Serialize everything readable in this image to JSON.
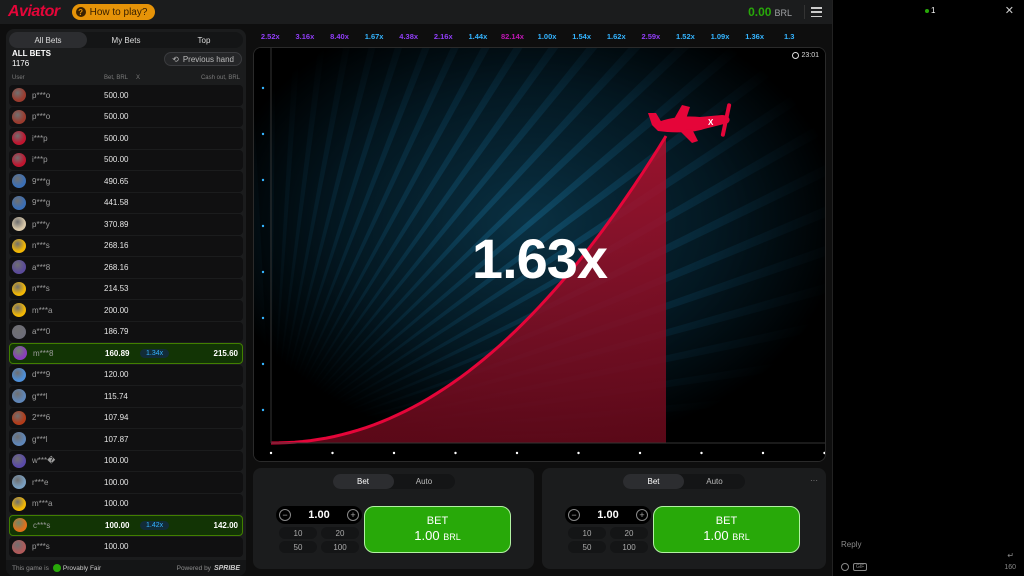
{
  "topbar": {
    "logo": "Aviator",
    "how_to_play": "How to play?",
    "balance_amount": "0.00",
    "balance_currency": "BRL"
  },
  "bets_panel": {
    "tabs": [
      "All Bets",
      "My Bets",
      "Top"
    ],
    "active_tab": "All Bets",
    "title": "ALL BETS",
    "count": "1176",
    "previous_hand": "Previous hand",
    "columns": {
      "user": "User",
      "bet": "Bet, BRL",
      "x": "X",
      "cashout": "Cash out, BRL"
    },
    "rows": [
      {
        "user": "p***o",
        "bet": "500.00",
        "mult": "",
        "cash": "",
        "win": false,
        "avatar": "#9b3b2e"
      },
      {
        "user": "p***o",
        "bet": "500.00",
        "mult": "",
        "cash": "",
        "win": false,
        "avatar": "#9b3b2e"
      },
      {
        "user": "i***p",
        "bet": "500.00",
        "mult": "",
        "cash": "",
        "win": false,
        "avatar": "#c0152f"
      },
      {
        "user": "i***p",
        "bet": "500.00",
        "mult": "",
        "cash": "",
        "win": false,
        "avatar": "#c0152f"
      },
      {
        "user": "9***g",
        "bet": "490.65",
        "mult": "",
        "cash": "",
        "win": false,
        "avatar": "#3b6fb6"
      },
      {
        "user": "9***g",
        "bet": "441.58",
        "mult": "",
        "cash": "",
        "win": false,
        "avatar": "#3b6fb6"
      },
      {
        "user": "p***y",
        "bet": "370.89",
        "mult": "",
        "cash": "",
        "win": false,
        "avatar": "#d8c7a8"
      },
      {
        "user": "n***s",
        "bet": "268.16",
        "mult": "",
        "cash": "",
        "win": false,
        "avatar": "#f2b705"
      },
      {
        "user": "a***8",
        "bet": "268.16",
        "mult": "",
        "cash": "",
        "win": false,
        "avatar": "#5b4b9a"
      },
      {
        "user": "n***s",
        "bet": "214.53",
        "mult": "",
        "cash": "",
        "win": false,
        "avatar": "#f2b705"
      },
      {
        "user": "m***a",
        "bet": "200.00",
        "mult": "",
        "cash": "",
        "win": false,
        "avatar": "#f2b705"
      },
      {
        "user": "a***0",
        "bet": "186.79",
        "mult": "",
        "cash": "",
        "win": false,
        "avatar": "#6d6d78"
      },
      {
        "user": "m***8",
        "bet": "160.89",
        "mult": "1.34x",
        "cash": "215.60",
        "win": true,
        "avatar": "#8a3dbd"
      },
      {
        "user": "d***9",
        "bet": "120.00",
        "mult": "",
        "cash": "",
        "win": false,
        "avatar": "#4e8fd8"
      },
      {
        "user": "g***l",
        "bet": "115.74",
        "mult": "",
        "cash": "",
        "win": false,
        "avatar": "#5f86b8"
      },
      {
        "user": "2***6",
        "bet": "107.94",
        "mult": "",
        "cash": "",
        "win": false,
        "avatar": "#b23c1a"
      },
      {
        "user": "g***l",
        "bet": "107.87",
        "mult": "",
        "cash": "",
        "win": false,
        "avatar": "#5f86b8"
      },
      {
        "user": "w***�",
        "bet": "100.00",
        "mult": "",
        "cash": "",
        "win": false,
        "avatar": "#5a4aa8"
      },
      {
        "user": "r***e",
        "bet": "100.00",
        "mult": "",
        "cash": "",
        "win": false,
        "avatar": "#7a9fc0"
      },
      {
        "user": "m***a",
        "bet": "100.00",
        "mult": "",
        "cash": "",
        "win": false,
        "avatar": "#f2b705"
      },
      {
        "user": "c***s",
        "bet": "100.00",
        "mult": "1.42x",
        "cash": "142.00",
        "win": true,
        "avatar": "#e0701a"
      },
      {
        "user": "p***s",
        "bet": "100.00",
        "mult": "",
        "cash": "",
        "win": false,
        "avatar": "#b05a5a"
      }
    ],
    "footer": {
      "this_game_is": "This game is",
      "provably_fair": "Provably Fair",
      "powered_by": "Powered by",
      "brand": "SPRIBE"
    }
  },
  "history": [
    {
      "value": "2.52x",
      "color": "#913ef8"
    },
    {
      "value": "3.16x",
      "color": "#913ef8"
    },
    {
      "value": "8.40x",
      "color": "#913ef8"
    },
    {
      "value": "1.67x",
      "color": "#34b4ff"
    },
    {
      "value": "4.38x",
      "color": "#913ef8"
    },
    {
      "value": "2.16x",
      "color": "#913ef8"
    },
    {
      "value": "1.44x",
      "color": "#34b4ff"
    },
    {
      "value": "82.14x",
      "color": "#c017b4"
    },
    {
      "value": "1.00x",
      "color": "#34b4ff"
    },
    {
      "value": "1.54x",
      "color": "#34b4ff"
    },
    {
      "value": "1.62x",
      "color": "#34b4ff"
    },
    {
      "value": "2.59x",
      "color": "#913ef8"
    },
    {
      "value": "1.52x",
      "color": "#34b4ff"
    },
    {
      "value": "1.09x",
      "color": "#34b4ff"
    },
    {
      "value": "1.36x",
      "color": "#34b4ff"
    },
    {
      "value": "1.3",
      "color": "#34b4ff"
    }
  ],
  "game": {
    "time": "23:01",
    "multiplier": "1.63x",
    "curve_color": "#e50539"
  },
  "bet_panels": [
    {
      "tabs": [
        "Bet",
        "Auto"
      ],
      "active": "Bet",
      "stake": "1.00",
      "quick": [
        "10",
        "20",
        "50",
        "100"
      ],
      "button_label": "BET",
      "button_amount": "1.00",
      "button_currency": "BRL",
      "more": ""
    },
    {
      "tabs": [
        "Bet",
        "Auto"
      ],
      "active": "Bet",
      "stake": "1.00",
      "quick": [
        "10",
        "20",
        "50",
        "100"
      ],
      "button_label": "BET",
      "button_amount": "1.00",
      "button_currency": "BRL",
      "more": "···"
    }
  ],
  "chat": {
    "online": "1",
    "reply": "Reply",
    "gif": "GIF",
    "char_count": "160"
  }
}
